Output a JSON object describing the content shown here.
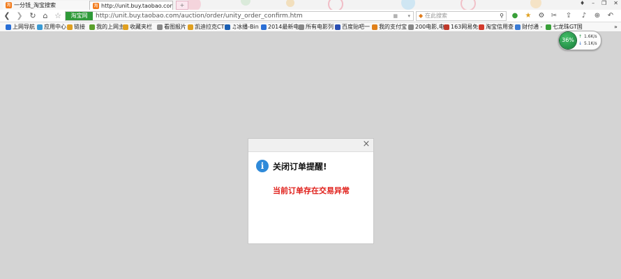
{
  "tabs": [
    {
      "label": "一分钱_淘宝搜索"
    },
    {
      "label": "http://unit.buy.taobao.con",
      "close": "×"
    }
  ],
  "new_tab_label": "+",
  "window_controls": [
    "♦",
    "–",
    "❐",
    "✕"
  ],
  "nav": {
    "back": "❮",
    "forward": "❯",
    "reload": "↻",
    "home": "⌂",
    "favorite": "☆",
    "site_badge": "淘宝网",
    "url": "http://unit.buy.taobao.com/auction/order/unity_order_confirm.htm",
    "search_placeholder": "在此搜索"
  },
  "bookmarks": [
    {
      "label": "上网导航",
      "color": "#2a6fd6"
    },
    {
      "label": "应用中心",
      "color": "#3a9bd5"
    },
    {
      "label": "链接",
      "color": "#e0a020"
    },
    {
      "label": "我的上网主",
      "color": "#5aa02c"
    },
    {
      "label": "收藏夹栏",
      "color": "#e0a020"
    },
    {
      "label": "看图报片",
      "color": "#888888"
    },
    {
      "label": "凯迪拉克CT",
      "color": "#e0a020"
    },
    {
      "label": "♫冰播-Bin",
      "color": "#1b5fb3"
    },
    {
      "label": "2014最新电",
      "color": "#2a6fd6"
    },
    {
      "label": "所有电影列",
      "color": "#888888"
    },
    {
      "label": "百度贴吧一",
      "color": "#2a4fb3"
    },
    {
      "label": "我的支付宝",
      "color": "#e0801a"
    },
    {
      "label": "200电影,电",
      "color": "#888888"
    },
    {
      "label": "163网易免",
      "color": "#c0392b"
    },
    {
      "label": "淘宝信用查",
      "color": "#d33a2c"
    },
    {
      "label": "财付通 -",
      "color": "#3a7bd5"
    },
    {
      "label": "七龙珠GT国",
      "color": "#3aa03a"
    }
  ],
  "net": {
    "percent": "36%",
    "up": "1.6K/s",
    "down": "5.1K/s",
    "up_arrow": "↑",
    "down_arrow": "↓"
  },
  "dialog": {
    "close": "×",
    "info_icon": "i",
    "title": "关闭订单提醒!",
    "message": "当前订单存在交易异常",
    "message_color": "#e0201b"
  }
}
